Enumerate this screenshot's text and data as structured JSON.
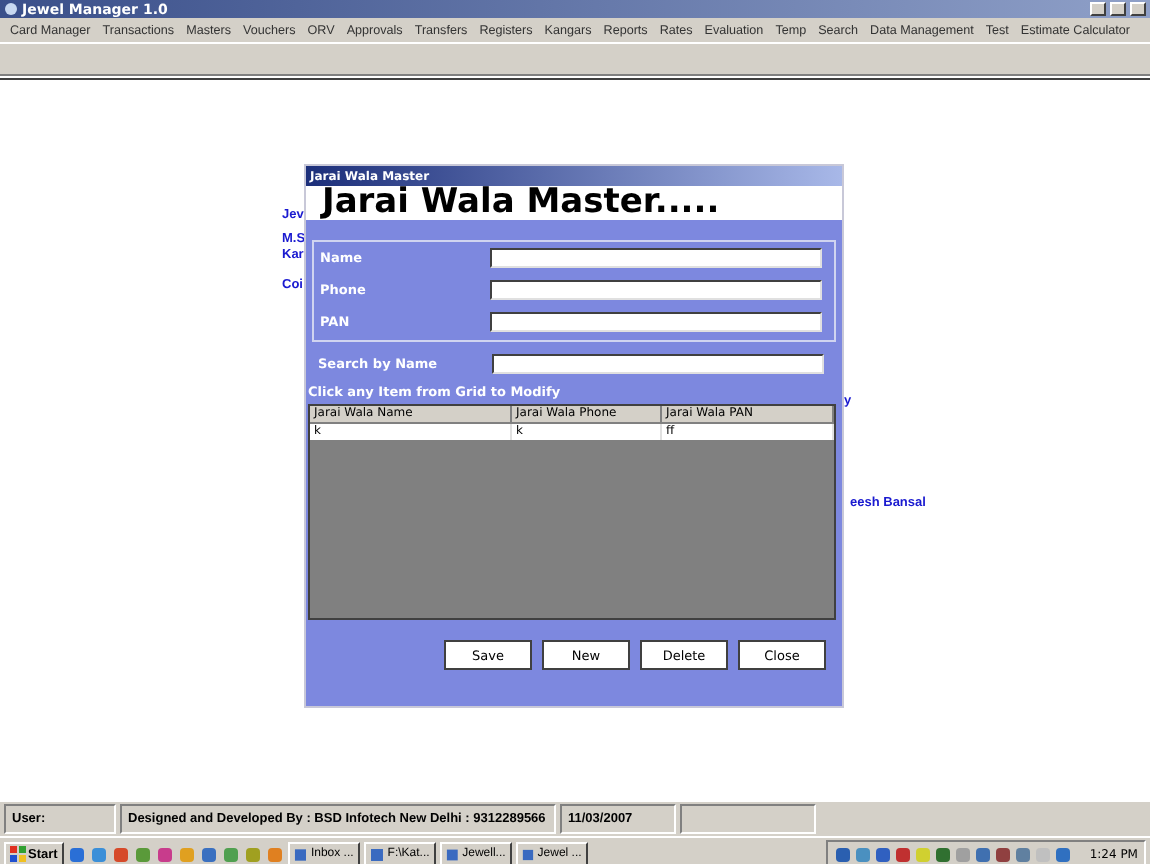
{
  "window": {
    "title": "Jewel Manager 1.0"
  },
  "menu": [
    "Card Manager",
    "Transactions",
    "Masters",
    "Vouchers",
    "ORV",
    "Approvals",
    "Transfers",
    "Registers",
    "Kangars",
    "Reports",
    "Rates",
    "Evaluation",
    "Temp",
    "Search",
    "Data Management",
    "Test",
    "Estimate Calculator"
  ],
  "background_texts": [
    {
      "text": "Jev",
      "kind": "left"
    },
    {
      "text": "M.S",
      "kind": "left"
    },
    {
      "text": "Kar",
      "kind": "left"
    },
    {
      "text": "Coi",
      "kind": "left"
    },
    {
      "text": "y",
      "kind": "right"
    },
    {
      "text": "eesh Bansal",
      "kind": "right"
    }
  ],
  "dialog": {
    "title": "Jarai Wala Master",
    "heading": "Jarai Wala Master.....",
    "fields": [
      {
        "label": "Name"
      },
      {
        "label": "Phone"
      },
      {
        "label": "PAN"
      }
    ],
    "search": {
      "label": "Search by Name"
    },
    "hint": "Click any Item from Grid to Modify",
    "table": {
      "columns": [
        "Jarai Wala Name",
        "Jarai Wala Phone",
        "Jarai Wala PAN"
      ],
      "rows": [
        [
          "k",
          "k",
          "ff"
        ]
      ]
    },
    "buttons": [
      "Save",
      "New",
      "Delete",
      "Close"
    ]
  },
  "status_bar": [
    "User:",
    "Designed and Developed By : BSD Infotech New Delhi : 9312289566",
    "11/03/2007"
  ],
  "taskbar": {
    "start": "Start",
    "tasks": [
      "Inbox ...",
      "F:\\Kat...",
      "Jewell...",
      "Jewel ..."
    ],
    "clock": "1:24 PM"
  }
}
